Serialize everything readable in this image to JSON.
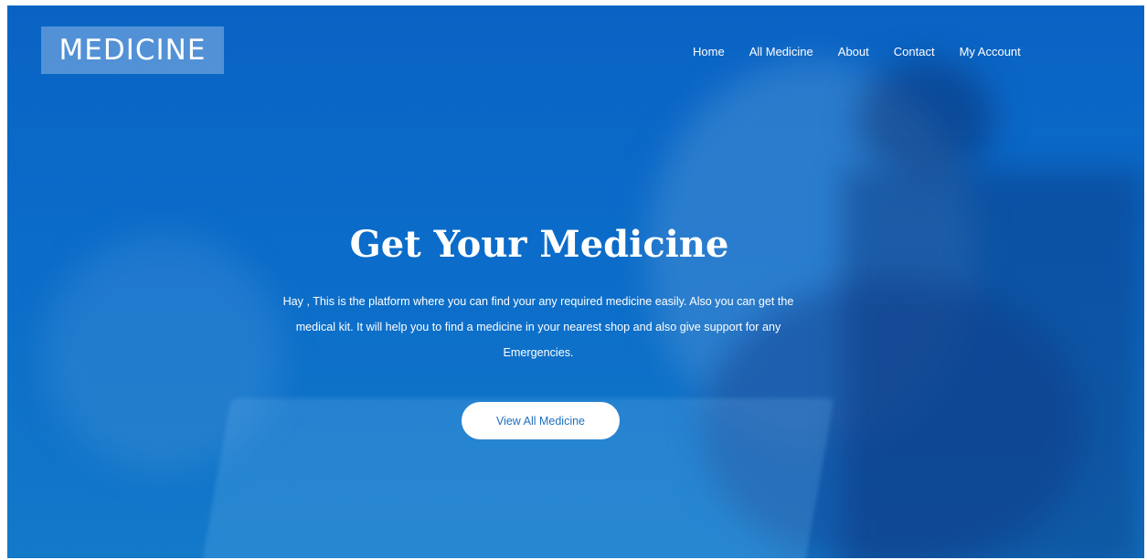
{
  "brand": {
    "logo_text": "MEDICINE"
  },
  "nav": {
    "items": [
      {
        "label": "Home"
      },
      {
        "label": "All Medicine"
      },
      {
        "label": "About"
      },
      {
        "label": "Contact"
      },
      {
        "label": "My Account"
      }
    ]
  },
  "hero": {
    "title": "Get Your Medicine",
    "description": "Hay , This is the platform where you can find your any required medicine easily. Also you can get the medical kit. It will help you to find a medicine in your nearest shop and also give support for any Emergencies.",
    "cta_label": "View All Medicine"
  },
  "colors": {
    "hero_blue": "#0b6cc9",
    "cta_text": "#1f6fbd",
    "white": "#ffffff"
  }
}
